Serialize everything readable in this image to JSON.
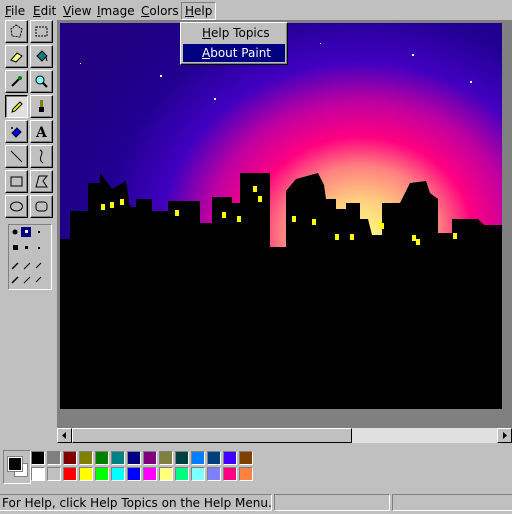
{
  "menubar": {
    "items": [
      {
        "id": "file",
        "pre": "",
        "u": "F",
        "post": "ile"
      },
      {
        "id": "edit",
        "pre": "",
        "u": "E",
        "post": "dit"
      },
      {
        "id": "view",
        "pre": "",
        "u": "V",
        "post": "iew"
      },
      {
        "id": "image",
        "pre": "",
        "u": "I",
        "post": "mage"
      },
      {
        "id": "colors",
        "pre": "",
        "u": "C",
        "post": "olors"
      },
      {
        "id": "help",
        "pre": "",
        "u": "H",
        "post": "elp"
      }
    ]
  },
  "help_menu": {
    "items": [
      {
        "pre": "",
        "u": "H",
        "post": "elp Topics"
      },
      {
        "pre": "",
        "u": "A",
        "post": "bout Paint"
      }
    ],
    "selected_index": 1
  },
  "toolbox": {
    "tools": [
      "free-form-select",
      "select",
      "eraser",
      "fill-with-color",
      "pick-color",
      "magnifier",
      "pencil",
      "brush",
      "airbrush",
      "text",
      "line",
      "curve",
      "rectangle",
      "polygon",
      "ellipse",
      "rounded-rectangle"
    ],
    "active_tool": "pencil"
  },
  "palette": {
    "foreground": "#000000",
    "background": "#ffffff",
    "top_row": [
      "#000000",
      "#808080",
      "#800000",
      "#808000",
      "#008000",
      "#008080",
      "#000080",
      "#800080",
      "#808040",
      "#004040",
      "#0080ff",
      "#004080",
      "#4000ff",
      "#804000"
    ],
    "bottom_row": [
      "#ffffff",
      "#c0c0c0",
      "#ff0000",
      "#ffff00",
      "#00ff00",
      "#00ffff",
      "#0000ff",
      "#ff00ff",
      "#ffff80",
      "#00ff80",
      "#80ffff",
      "#8080ff",
      "#ff0080",
      "#ff8040"
    ]
  },
  "status": {
    "message": "For Help, click Help Topics on the Help Menu."
  }
}
